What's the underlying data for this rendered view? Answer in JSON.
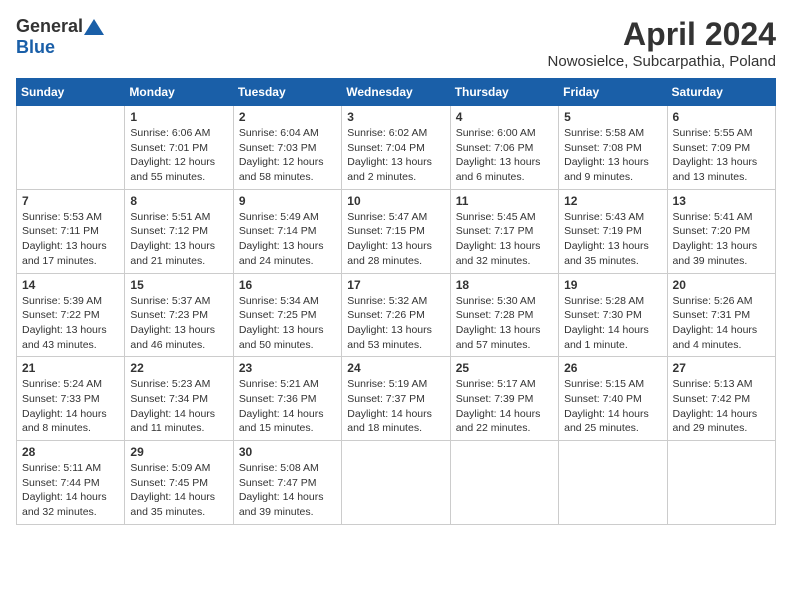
{
  "header": {
    "logo_general": "General",
    "logo_blue": "Blue",
    "month": "April 2024",
    "location": "Nowosielce, Subcarpathia, Poland"
  },
  "days_of_week": [
    "Sunday",
    "Monday",
    "Tuesday",
    "Wednesday",
    "Thursday",
    "Friday",
    "Saturday"
  ],
  "weeks": [
    [
      {
        "day": "",
        "detail": ""
      },
      {
        "day": "1",
        "detail": "Sunrise: 6:06 AM\nSunset: 7:01 PM\nDaylight: 12 hours\nand 55 minutes."
      },
      {
        "day": "2",
        "detail": "Sunrise: 6:04 AM\nSunset: 7:03 PM\nDaylight: 12 hours\nand 58 minutes."
      },
      {
        "day": "3",
        "detail": "Sunrise: 6:02 AM\nSunset: 7:04 PM\nDaylight: 13 hours\nand 2 minutes."
      },
      {
        "day": "4",
        "detail": "Sunrise: 6:00 AM\nSunset: 7:06 PM\nDaylight: 13 hours\nand 6 minutes."
      },
      {
        "day": "5",
        "detail": "Sunrise: 5:58 AM\nSunset: 7:08 PM\nDaylight: 13 hours\nand 9 minutes."
      },
      {
        "day": "6",
        "detail": "Sunrise: 5:55 AM\nSunset: 7:09 PM\nDaylight: 13 hours\nand 13 minutes."
      }
    ],
    [
      {
        "day": "7",
        "detail": "Sunrise: 5:53 AM\nSunset: 7:11 PM\nDaylight: 13 hours\nand 17 minutes."
      },
      {
        "day": "8",
        "detail": "Sunrise: 5:51 AM\nSunset: 7:12 PM\nDaylight: 13 hours\nand 21 minutes."
      },
      {
        "day": "9",
        "detail": "Sunrise: 5:49 AM\nSunset: 7:14 PM\nDaylight: 13 hours\nand 24 minutes."
      },
      {
        "day": "10",
        "detail": "Sunrise: 5:47 AM\nSunset: 7:15 PM\nDaylight: 13 hours\nand 28 minutes."
      },
      {
        "day": "11",
        "detail": "Sunrise: 5:45 AM\nSunset: 7:17 PM\nDaylight: 13 hours\nand 32 minutes."
      },
      {
        "day": "12",
        "detail": "Sunrise: 5:43 AM\nSunset: 7:19 PM\nDaylight: 13 hours\nand 35 minutes."
      },
      {
        "day": "13",
        "detail": "Sunrise: 5:41 AM\nSunset: 7:20 PM\nDaylight: 13 hours\nand 39 minutes."
      }
    ],
    [
      {
        "day": "14",
        "detail": "Sunrise: 5:39 AM\nSunset: 7:22 PM\nDaylight: 13 hours\nand 43 minutes."
      },
      {
        "day": "15",
        "detail": "Sunrise: 5:37 AM\nSunset: 7:23 PM\nDaylight: 13 hours\nand 46 minutes."
      },
      {
        "day": "16",
        "detail": "Sunrise: 5:34 AM\nSunset: 7:25 PM\nDaylight: 13 hours\nand 50 minutes."
      },
      {
        "day": "17",
        "detail": "Sunrise: 5:32 AM\nSunset: 7:26 PM\nDaylight: 13 hours\nand 53 minutes."
      },
      {
        "day": "18",
        "detail": "Sunrise: 5:30 AM\nSunset: 7:28 PM\nDaylight: 13 hours\nand 57 minutes."
      },
      {
        "day": "19",
        "detail": "Sunrise: 5:28 AM\nSunset: 7:30 PM\nDaylight: 14 hours\nand 1 minute."
      },
      {
        "day": "20",
        "detail": "Sunrise: 5:26 AM\nSunset: 7:31 PM\nDaylight: 14 hours\nand 4 minutes."
      }
    ],
    [
      {
        "day": "21",
        "detail": "Sunrise: 5:24 AM\nSunset: 7:33 PM\nDaylight: 14 hours\nand 8 minutes."
      },
      {
        "day": "22",
        "detail": "Sunrise: 5:23 AM\nSunset: 7:34 PM\nDaylight: 14 hours\nand 11 minutes."
      },
      {
        "day": "23",
        "detail": "Sunrise: 5:21 AM\nSunset: 7:36 PM\nDaylight: 14 hours\nand 15 minutes."
      },
      {
        "day": "24",
        "detail": "Sunrise: 5:19 AM\nSunset: 7:37 PM\nDaylight: 14 hours\nand 18 minutes."
      },
      {
        "day": "25",
        "detail": "Sunrise: 5:17 AM\nSunset: 7:39 PM\nDaylight: 14 hours\nand 22 minutes."
      },
      {
        "day": "26",
        "detail": "Sunrise: 5:15 AM\nSunset: 7:40 PM\nDaylight: 14 hours\nand 25 minutes."
      },
      {
        "day": "27",
        "detail": "Sunrise: 5:13 AM\nSunset: 7:42 PM\nDaylight: 14 hours\nand 29 minutes."
      }
    ],
    [
      {
        "day": "28",
        "detail": "Sunrise: 5:11 AM\nSunset: 7:44 PM\nDaylight: 14 hours\nand 32 minutes."
      },
      {
        "day": "29",
        "detail": "Sunrise: 5:09 AM\nSunset: 7:45 PM\nDaylight: 14 hours\nand 35 minutes."
      },
      {
        "day": "30",
        "detail": "Sunrise: 5:08 AM\nSunset: 7:47 PM\nDaylight: 14 hours\nand 39 minutes."
      },
      {
        "day": "",
        "detail": ""
      },
      {
        "day": "",
        "detail": ""
      },
      {
        "day": "",
        "detail": ""
      },
      {
        "day": "",
        "detail": ""
      }
    ]
  ]
}
